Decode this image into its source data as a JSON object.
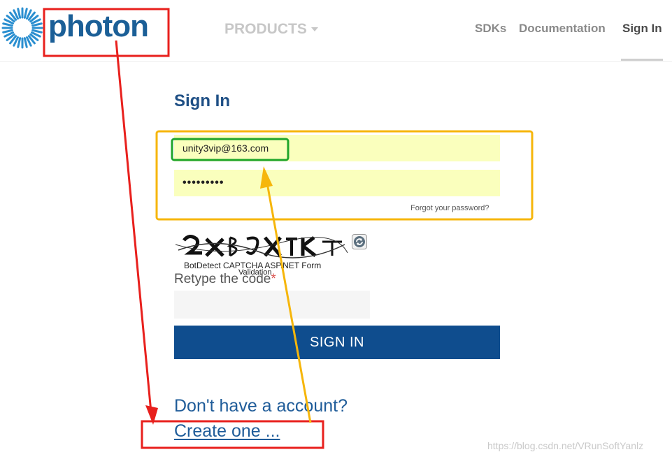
{
  "header": {
    "logo_text": "photon",
    "nav": {
      "products": "PRODUCTS",
      "sdks": "SDKs",
      "documentation": "Documentation",
      "sign_in": "Sign In"
    }
  },
  "form": {
    "title": "Sign In",
    "email_value": "unity3vip@163.com",
    "password_value": "•••••••••",
    "forgot_password": "Forgot your password?",
    "captcha_caption": "BotDetect CAPTCHA ASP.NET Form",
    "captcha_validation": "Validation",
    "retype_label": "Retype the code",
    "required_mark": "*",
    "submit_label": "SIGN IN"
  },
  "footer": {
    "no_account": "Don't have a account?",
    "create_link": "Create one ..."
  },
  "watermark": "https://blog.csdn.net/VRunSoftYanlz",
  "colors": {
    "brand": "#1b5f97",
    "button": "#0f4d8e",
    "autofill": "#faffbd",
    "annotation_red": "#e8201d",
    "annotation_yellow": "#f6b60b",
    "annotation_green": "#1fa52a"
  }
}
